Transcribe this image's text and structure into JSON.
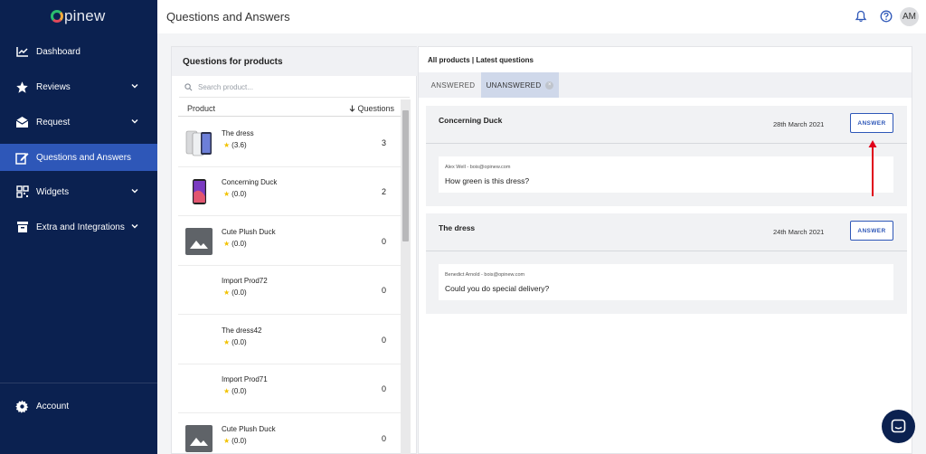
{
  "app": {
    "logo_text": "pinew"
  },
  "sidebar": {
    "items": [
      {
        "label": "Dashboard",
        "icon": "chart-line-icon",
        "has_chevron": false,
        "active": false
      },
      {
        "label": "Reviews",
        "icon": "star-icon",
        "has_chevron": true,
        "active": false
      },
      {
        "label": "Request",
        "icon": "envelope-icon",
        "has_chevron": true,
        "active": false
      },
      {
        "label": "Questions and Answers",
        "icon": "edit-icon",
        "has_chevron": false,
        "active": true
      },
      {
        "label": "Widgets",
        "icon": "widgets-icon",
        "has_chevron": true,
        "active": false
      },
      {
        "label": "Extra and Integrations",
        "icon": "archive-icon",
        "has_chevron": true,
        "active": false
      }
    ],
    "account_label": "Account"
  },
  "header": {
    "title": "Questions and Answers",
    "avatar_initials": "AM"
  },
  "products_panel": {
    "title": "Questions for products",
    "search_placeholder": "Search product...",
    "columns": {
      "product": "Product",
      "questions": "Questions"
    },
    "rows": [
      {
        "name": "The dress",
        "rating": "(3.6)",
        "count": "3",
        "thumb": "phones"
      },
      {
        "name": "Concerning Duck",
        "rating": "(0.0)",
        "count": "2",
        "thumb": "phone"
      },
      {
        "name": "Cute Plush Duck",
        "rating": "(0.0)",
        "count": "0",
        "thumb": "placeholder"
      },
      {
        "name": "Import Prod72",
        "rating": "(0.0)",
        "count": "0",
        "thumb": "none"
      },
      {
        "name": "The dress42",
        "rating": "(0.0)",
        "count": "0",
        "thumb": "none"
      },
      {
        "name": "Import Prod71",
        "rating": "(0.0)",
        "count": "0",
        "thumb": "none"
      },
      {
        "name": "Cute Plush Duck",
        "rating": "(0.0)",
        "count": "0",
        "thumb": "placeholder"
      }
    ]
  },
  "questions_panel": {
    "breadcrumb": "All products | Latest questions",
    "tabs": [
      {
        "label": "ANSWERED",
        "active": false
      },
      {
        "label": "UNANSWERED",
        "active": true
      }
    ],
    "tab_clear_glyph": "×",
    "questions": [
      {
        "product": "Concerning Duck",
        "date": "28th March 2021",
        "answer_label": "ANSWER",
        "author": "Alex Well - bois@opinew.com",
        "text": "How green is this dress?"
      },
      {
        "product": "The dress",
        "date": "24th March 2021",
        "answer_label": "ANSWER",
        "author": "Benedict Arnold - bois@opinew.com",
        "text": "Could you do special delivery?"
      }
    ]
  },
  "colors": {
    "sidebar_bg": "#0b2150",
    "active_item": "#2e57b8",
    "accent": "#2e57b8",
    "star": "#f2c200",
    "annotation_arrow": "#e0001a"
  }
}
